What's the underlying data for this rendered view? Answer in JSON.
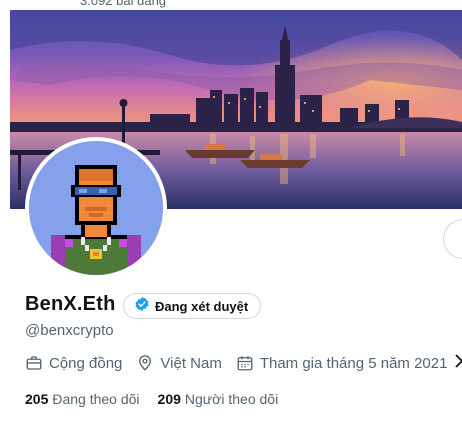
{
  "header": {
    "posts_count": "3.092 bài đăng"
  },
  "profile": {
    "display_name": "BenX.Eth",
    "verify_label": "Đang xét duyệt",
    "handle": "@benxcrypto",
    "category": "Cộng đồng",
    "location": "Việt Nam",
    "joined": "Tham gia tháng 5 năm 2021"
  },
  "stats": {
    "following_count": "205",
    "following_label": "Đang theo dõi",
    "followers_count": "209",
    "followers_label": "Người theo dõi"
  },
  "colors": {
    "accent": "#1d9bf0",
    "secondary_text": "#536471",
    "avatar_bg": "#85a1ec"
  },
  "icons": [
    "briefcase-icon",
    "location-pin-icon",
    "calendar-icon",
    "chevron-right-icon",
    "verified-check-icon"
  ]
}
